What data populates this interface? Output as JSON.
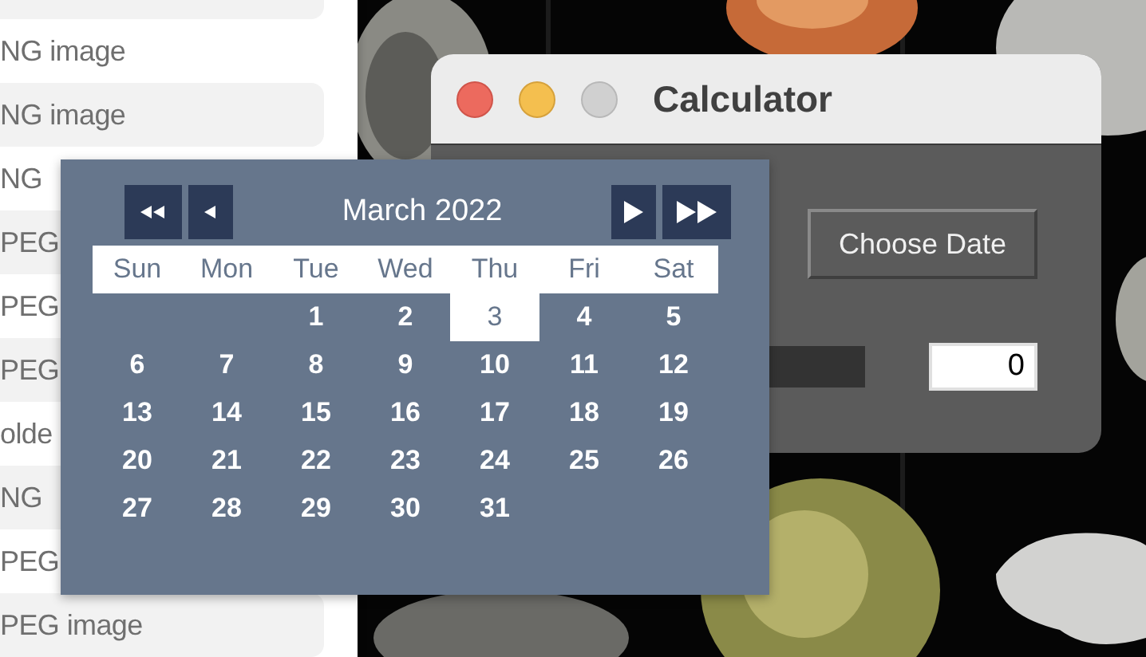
{
  "file_list": {
    "items": [
      {
        "label": "NG image"
      },
      {
        "label": "NG image"
      },
      {
        "label": "NG"
      },
      {
        "label": "PEG"
      },
      {
        "label": "PEG"
      },
      {
        "label": "PEG"
      },
      {
        "label": "olde"
      },
      {
        "label": "NG"
      },
      {
        "label": "PEG"
      },
      {
        "label": "PEG image"
      }
    ]
  },
  "calculator_window": {
    "title": "Calculator",
    "zoom_enabled": false,
    "choose_date_button": "Choose Date",
    "entry": {
      "value": "0"
    }
  },
  "date_picker": {
    "title": "March 2022",
    "weekdays": [
      "Sun",
      "Mon",
      "Tue",
      "Wed",
      "Thu",
      "Fri",
      "Sat"
    ],
    "weeks": [
      [
        {
          "day": "1",
          "selected": false
        },
        {
          "day": "2",
          "selected": false
        },
        {
          "day": "3",
          "selected": true
        },
        {
          "day": "4",
          "selected": false
        },
        {
          "day": "5",
          "selected": false
        }
      ],
      [
        {
          "day": "6",
          "selected": false
        },
        {
          "day": "7",
          "selected": false
        },
        {
          "day": "8",
          "selected": false
        },
        {
          "day": "9",
          "selected": false
        },
        {
          "day": "10",
          "selected": false
        },
        {
          "day": "11",
          "selected": false
        },
        {
          "day": "12",
          "selected": false
        }
      ],
      [
        {
          "day": "13",
          "selected": false
        },
        {
          "day": "14",
          "selected": false
        },
        {
          "day": "15",
          "selected": false
        },
        {
          "day": "16",
          "selected": false
        },
        {
          "day": "17",
          "selected": false
        },
        {
          "day": "18",
          "selected": false
        },
        {
          "day": "19",
          "selected": false
        }
      ],
      [
        {
          "day": "20",
          "selected": false
        },
        {
          "day": "21",
          "selected": false
        },
        {
          "day": "22",
          "selected": false
        },
        {
          "day": "23",
          "selected": false
        },
        {
          "day": "24",
          "selected": false
        },
        {
          "day": "25",
          "selected": false
        },
        {
          "day": "26",
          "selected": false
        }
      ],
      [
        {
          "day": "27",
          "selected": false
        },
        {
          "day": "28",
          "selected": false
        },
        {
          "day": "29",
          "selected": false
        },
        {
          "day": "30",
          "selected": false
        },
        {
          "day": "31",
          "selected": false
        }
      ]
    ]
  }
}
